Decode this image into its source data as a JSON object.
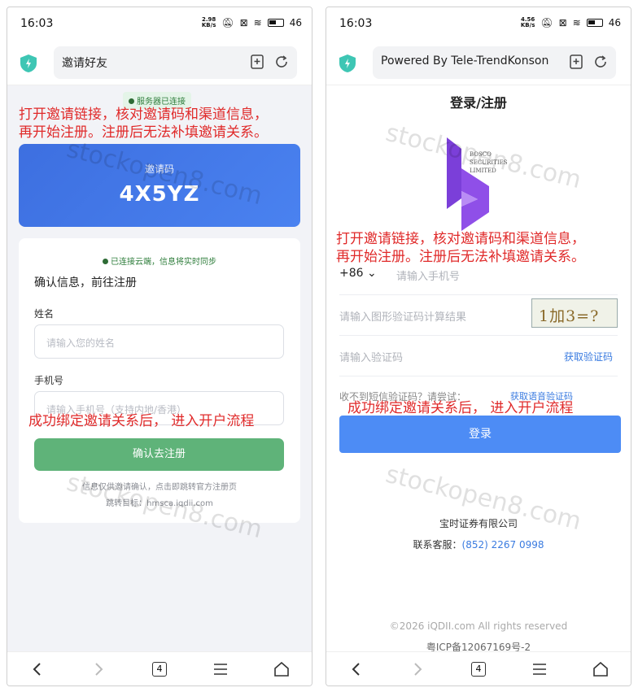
{
  "left": {
    "status": {
      "time": "16:03",
      "netspeed_top": "2.98",
      "netspeed_bottom": "KB/s",
      "battery": "46"
    },
    "url": "邀请好友",
    "server_badge": "服务器已连接",
    "notice_line1": "打开邀请链接，核对邀请码和渠道信息，",
    "notice_line2": "再开始注册。注册后无法补填邀请关系。",
    "code_label": "邀请码",
    "code_value": "4X5YZ",
    "sync_text": "已连接云端，信息将实时同步",
    "form_title": "确认信息，前往注册",
    "name_label": "姓名",
    "name_placeholder": "请输入您的姓名",
    "phone_label": "手机号",
    "phone_placeholder": "请输入手机号（支持内地/香港）",
    "bind_notice": "成功绑定邀请关系后， 进入开户流程",
    "confirm_button": "确认去注册",
    "info_note": "信息仅供邀请确认，点击即跳转官方注册页",
    "target_note": "跳转目标：hmsca.iqdii.com",
    "watermark": "stockopen8.com",
    "tab_count": "4"
  },
  "right": {
    "status": {
      "time": "16:03",
      "netspeed_top": "4.56",
      "netspeed_bottom": "KB/s",
      "battery": "46"
    },
    "url": "Powered By Tele-TrendKonson",
    "page_title": "登录/注册",
    "logo_text": [
      "BOSCO",
      "SECURITIES",
      "LIMITED"
    ],
    "notice_line1": "打开邀请链接，核对邀请码和渠道信息，",
    "notice_line2": "再开始注册。注册后无法补填邀请关系。",
    "country_code": "+86",
    "phone_placeholder": "请输入手机号",
    "captcha_placeholder": "请输入图形验证码计算结果",
    "captcha_text": "1加3=?",
    "sms_placeholder": "请输入验证码",
    "get_code": "获取验证码",
    "no_sms": "收不到短信验证码？请尝试：",
    "voice_code": "获取语音验证码",
    "bind_notice": "成功绑定邀请关系后， 进入开户流程",
    "login_button": "登录",
    "company": "宝时证券有限公司",
    "service_label": "联系客服：",
    "service_phone": "(852) 2267 0998",
    "copyright": "©2026 iQDII.com All rights reserved",
    "icp": "粤ICP备12067169号-2",
    "watermark": "stockopen8.com",
    "tab_count": "4"
  },
  "colors": {
    "accent_blue": "#4d8cf5",
    "green_button": "#5fb379",
    "notice_red": "#e02a2a",
    "shield_teal": "#3ec6b4"
  }
}
